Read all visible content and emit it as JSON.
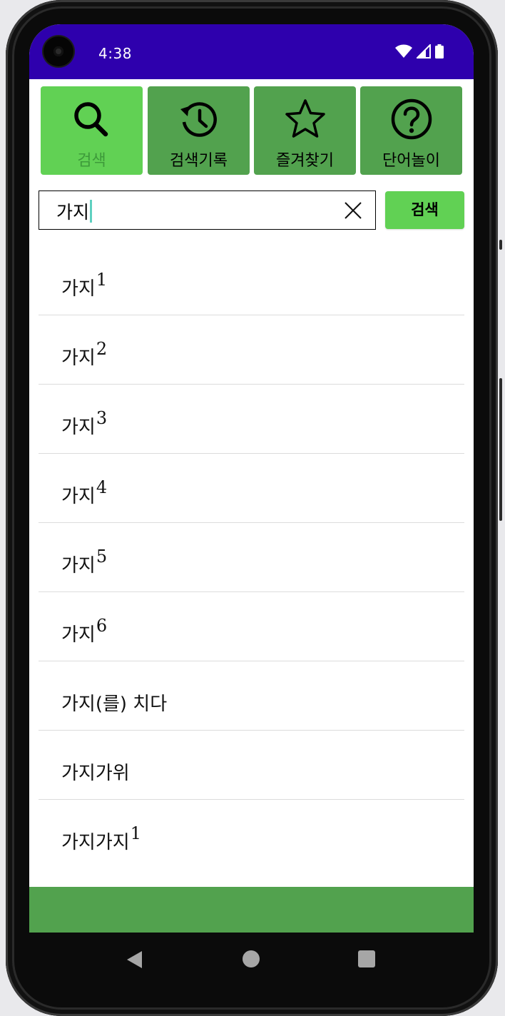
{
  "status_bar": {
    "time": "4:38",
    "background": "#2e00ad"
  },
  "menu": {
    "items": [
      {
        "label": "검색",
        "icon": "search-icon",
        "active": true
      },
      {
        "label": "검색기록",
        "icon": "history-icon",
        "active": false
      },
      {
        "label": "즐겨찾기",
        "icon": "star-icon",
        "active": false
      },
      {
        "label": "단어놀이",
        "icon": "help-icon",
        "active": false
      }
    ],
    "active_color": "#61d154",
    "inactive_color": "#52a24e"
  },
  "search": {
    "value": "가지",
    "button_label": "검색"
  },
  "results": [
    {
      "word": "가지",
      "sup": "1"
    },
    {
      "word": "가지",
      "sup": "2"
    },
    {
      "word": "가지",
      "sup": "3"
    },
    {
      "word": "가지",
      "sup": "4"
    },
    {
      "word": "가지",
      "sup": "5"
    },
    {
      "word": "가지",
      "sup": "6"
    },
    {
      "word": "가지(를) 치다",
      "sup": ""
    },
    {
      "word": "가지가위",
      "sup": ""
    },
    {
      "word": "가지가지",
      "sup": "1"
    }
  ]
}
